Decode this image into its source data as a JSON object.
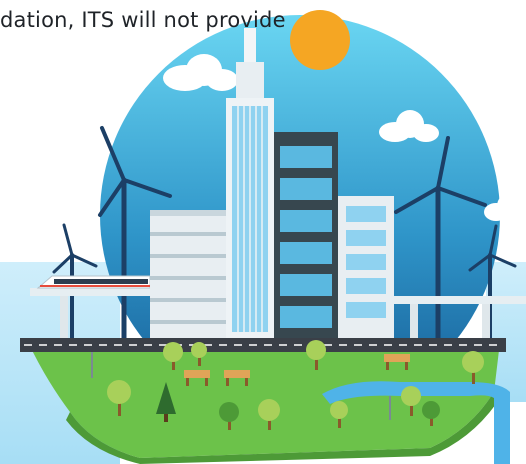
{
  "caption": "dation, ITS will not provide",
  "illustration": {
    "subject": "smart-city-illustration",
    "colors": {
      "sky_top": "#5fd0f0",
      "sky_bottom": "#1a6fae",
      "sun": "#f5a623",
      "cloud": "#ffffff",
      "grass": "#6cc24a",
      "grass_dark": "#4d9a37",
      "water": "#4fb3e8",
      "road": "#3a3f47",
      "turbine": "#1c3f66",
      "building_glass": "#8fd2f0",
      "building_dark": "#37474f"
    },
    "icons": [
      "sun-icon",
      "cloud-icon",
      "wind-turbine-icon",
      "train-icon",
      "tree-icon",
      "bench-icon",
      "lamp-post-icon"
    ]
  }
}
